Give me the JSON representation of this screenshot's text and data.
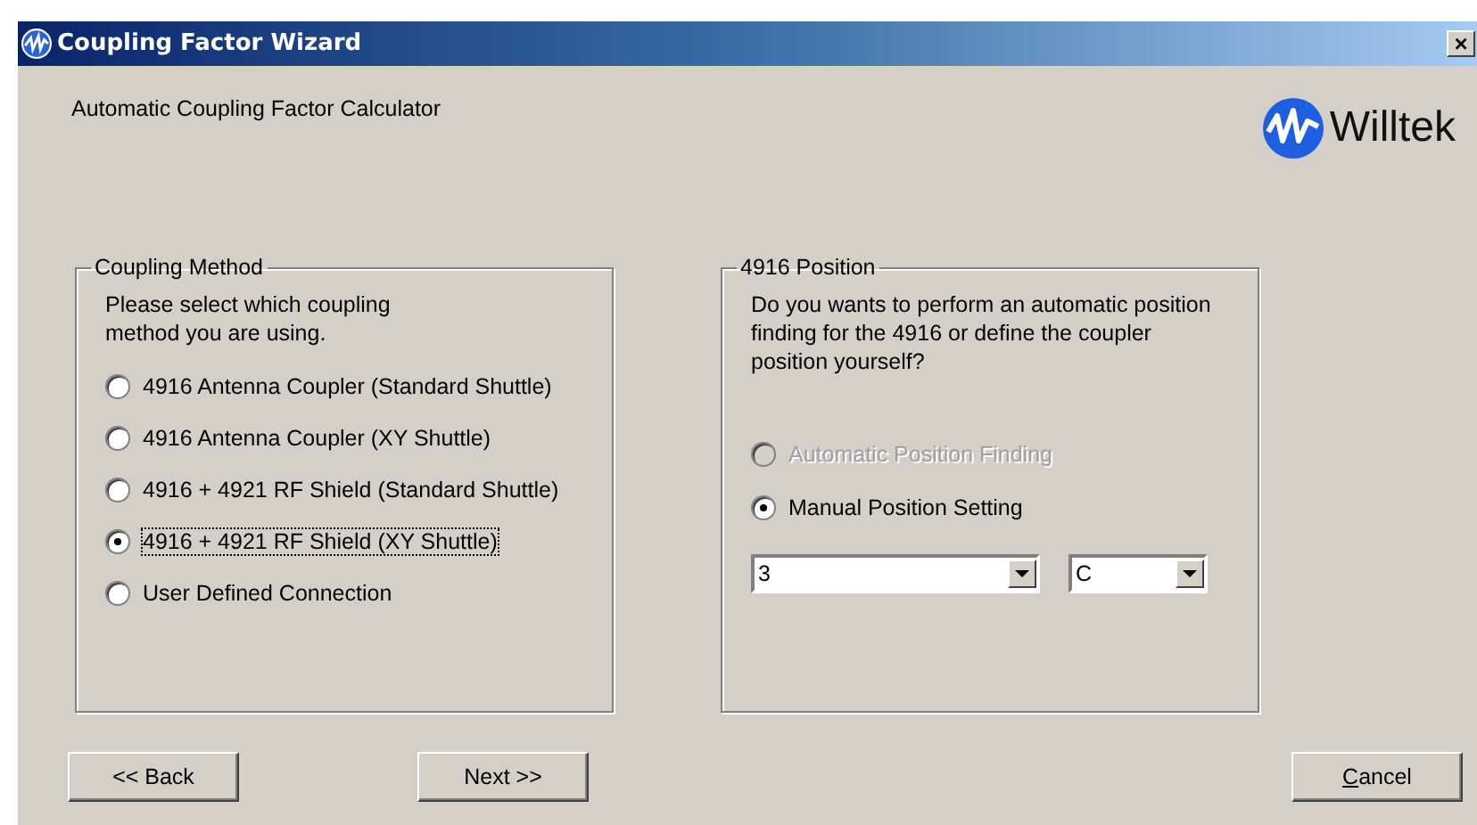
{
  "window": {
    "title": "Coupling Factor Wizard",
    "close": "×"
  },
  "subtitle": "Automatic Coupling Factor Calculator",
  "logo": {
    "text": "Willtek"
  },
  "coupling_method": {
    "legend": "Coupling Method",
    "prompt": "Please select which coupling method you are using.",
    "options": [
      {
        "label": "4916 Antenna Coupler (Standard Shuttle)",
        "selected": false,
        "disabled": false,
        "focused": false
      },
      {
        "label": "4916 Antenna Coupler (XY Shuttle)",
        "selected": false,
        "disabled": false,
        "focused": false
      },
      {
        "label": "4916 + 4921 RF Shield (Standard Shuttle)",
        "selected": false,
        "disabled": false,
        "focused": false
      },
      {
        "label": "4916 + 4921 RF Shield (XY Shuttle)",
        "selected": true,
        "disabled": false,
        "focused": true
      },
      {
        "label": "User Defined Connection",
        "selected": false,
        "disabled": false,
        "focused": false
      }
    ]
  },
  "position": {
    "legend": "4916 Position",
    "prompt": "Do you wants to perform an automatic position finding for the 4916 or define the coupler position yourself?",
    "options": [
      {
        "label": "Automatic Position Finding",
        "selected": false,
        "disabled": true,
        "focused": false
      },
      {
        "label": "Manual Position Setting",
        "selected": true,
        "disabled": false,
        "focused": false
      }
    ],
    "dropdowns": [
      {
        "value": "3"
      },
      {
        "value": "C"
      }
    ]
  },
  "buttons": [
    {
      "label": "<< Back",
      "kind": "back"
    },
    {
      "label": "Next >>",
      "kind": "next"
    },
    {
      "label": "Cancel",
      "kind": "cancel"
    }
  ]
}
